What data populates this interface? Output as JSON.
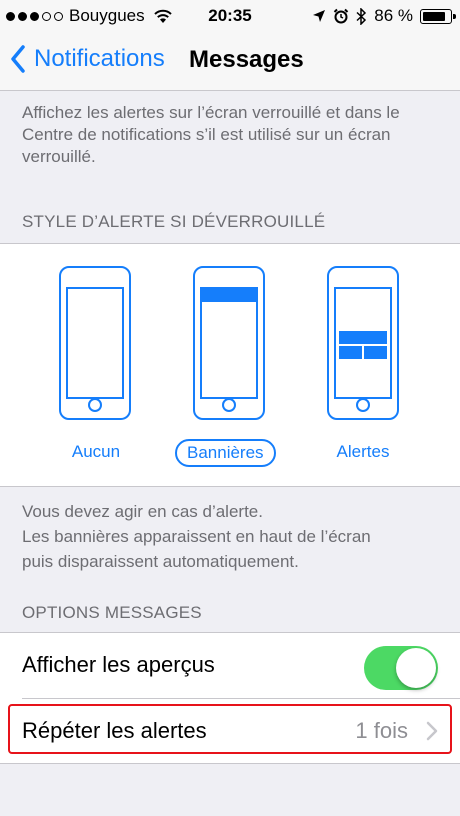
{
  "status_bar": {
    "carrier": "Bouygues",
    "time": "20:35",
    "battery": "86 %",
    "signal_bars_filled": 3,
    "signal_bars_total": 5
  },
  "nav": {
    "back_label": "Notifications",
    "title": "Messages"
  },
  "lock_description": "Affichez les alertes sur l’écran verrouillé et dans le Centre de notifications s’il est utilisé sur un écran verrouillé.",
  "alert_style": {
    "header": "STYLE D’ALERTE SI DÉVERROUILLÉ",
    "options": [
      "Aucun",
      "Bannières",
      "Alertes"
    ],
    "selected": "Bannières",
    "footer_line1": "Vous devez agir en cas d’alerte.",
    "footer_line2": "Les bannières apparaissent en haut de l’écran",
    "footer_line3": "puis disparaissent automatiquement."
  },
  "options": {
    "header": "OPTIONS MESSAGES",
    "show_previews_label": "Afficher les aperçus",
    "show_previews_on": true,
    "repeat_alerts_label": "Répéter les alertes",
    "repeat_alerts_value": "1 fois"
  },
  "colors": {
    "accent": "#157efb",
    "toggle_on": "#4cd964",
    "highlight": "#e7131a"
  }
}
